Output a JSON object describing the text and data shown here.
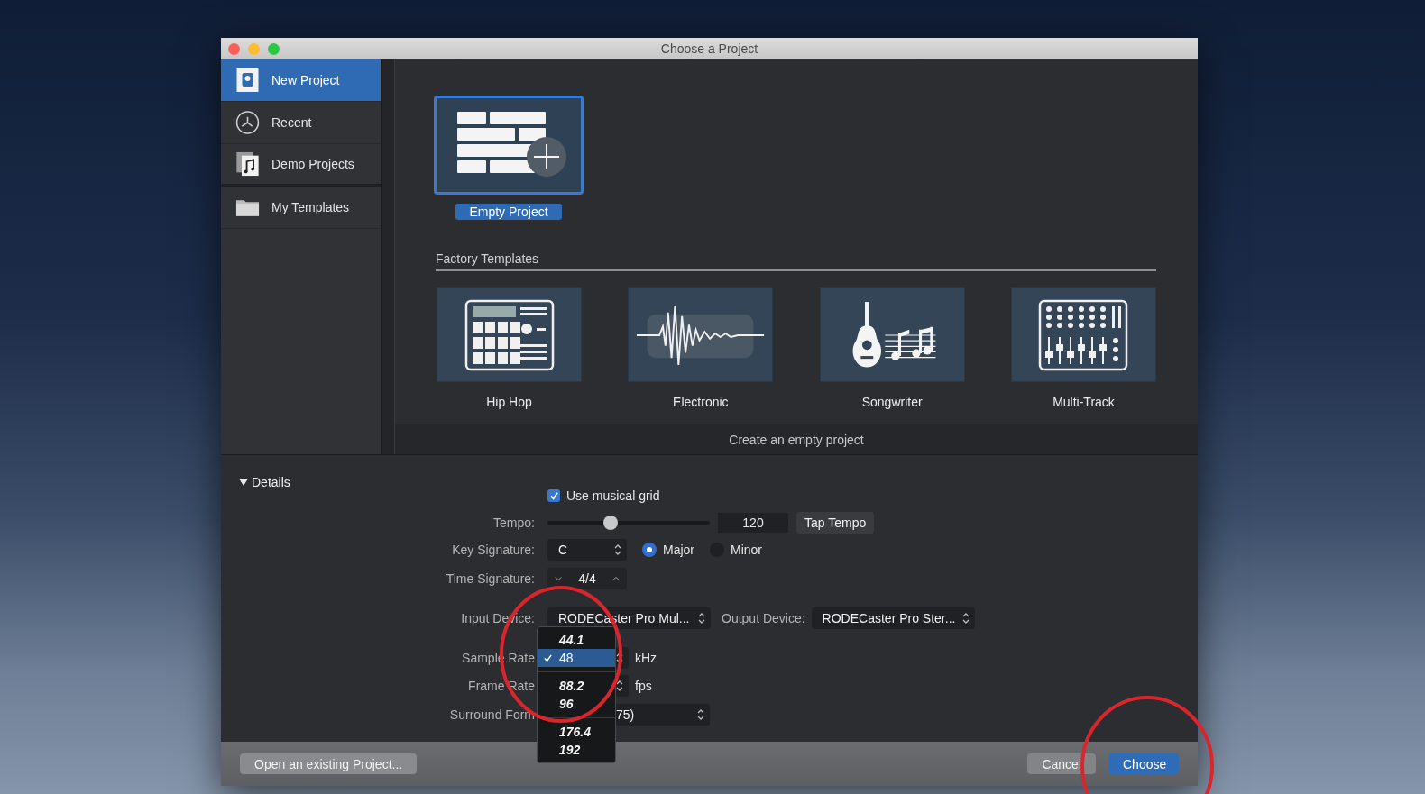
{
  "window": {
    "title": "Choose a Project"
  },
  "sidebar": {
    "items": [
      {
        "label": "New Project",
        "kind": "new",
        "selected": true
      },
      {
        "label": "Recent",
        "kind": "recent",
        "selected": false
      },
      {
        "label": "Demo Projects",
        "kind": "demo",
        "selected": false
      },
      {
        "label": "My Templates",
        "kind": "templates",
        "selected": false
      }
    ]
  },
  "empty_project": {
    "label": "Empty Project",
    "selected": true
  },
  "factory_templates": {
    "heading": "Factory Templates",
    "items": [
      {
        "label": "Hip Hop",
        "kind": "drum-machine",
        "selected": false
      },
      {
        "label": "Electronic",
        "kind": "waveform",
        "selected": false
      },
      {
        "label": "Songwriter",
        "kind": "guitar",
        "selected": false
      },
      {
        "label": "Multi-Track",
        "kind": "mixer",
        "selected": false
      }
    ]
  },
  "caption": "Create an empty project",
  "details": {
    "heading": "Details",
    "expanded": true,
    "use_musical_grid": {
      "label": "Use musical grid",
      "checked": true
    },
    "tempo": {
      "label": "Tempo:",
      "level": 0.39,
      "value": "120",
      "button": "Tap Tempo"
    },
    "key_signature": {
      "label": "Key Signature:",
      "value": "C",
      "modes": [
        {
          "label": "Major",
          "selected": true
        },
        {
          "label": "Minor",
          "selected": false
        }
      ]
    },
    "time_signature": {
      "label": "Time Signature:",
      "value": "4/4"
    },
    "input_device": {
      "label": "Input Device:",
      "value": "RODECaster Pro Mul..."
    },
    "output_device": {
      "label": "Output Device:",
      "value": "RODECaster Pro Ster..."
    },
    "sample_rate": {
      "label": "Sample Rate",
      "unit": "kHz"
    },
    "frame_rate": {
      "label": "Frame Rate",
      "unit": "fps"
    },
    "surround_format": {
      "label": "Surround Form",
      "value": "75)"
    },
    "sample_rate_menu": {
      "groups": [
        [
          {
            "label": "44.1",
            "selected": false
          },
          {
            "label": "48",
            "selected": true
          }
        ],
        [
          {
            "label": "88.2",
            "selected": false
          },
          {
            "label": "96",
            "selected": false
          }
        ],
        [
          {
            "label": "176.4",
            "selected": false
          },
          {
            "label": "192",
            "selected": false
          }
        ]
      ]
    }
  },
  "buttons": {
    "open_existing": "Open an existing Project...",
    "cancel": "Cancel",
    "choose": "Choose"
  }
}
